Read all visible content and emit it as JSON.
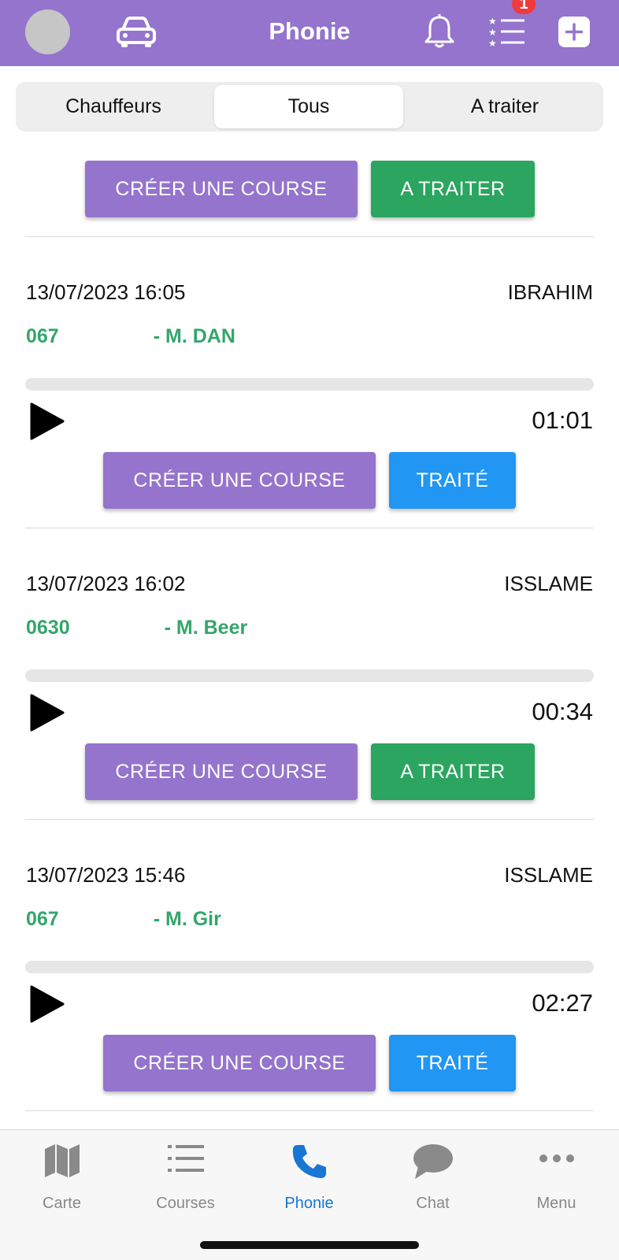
{
  "header": {
    "title": "Phonie",
    "notification_badge": "1",
    "icons": [
      "avatar",
      "car-icon",
      "bell-icon",
      "list-icon",
      "plus-icon"
    ]
  },
  "segment": {
    "items": [
      {
        "label": "Chauffeurs",
        "active": false
      },
      {
        "label": "Tous",
        "active": true
      },
      {
        "label": "A traiter",
        "active": false
      }
    ]
  },
  "top_actions": {
    "create_label": "CRÉER UNE COURSE",
    "status_label": "A TRAITER"
  },
  "calls": [
    {
      "datetime": "13/07/2023 16:05",
      "driver": "IBRAHIM",
      "phone_prefix": "067",
      "client": "- M. DAN",
      "duration": "01:01",
      "create_label": "CRÉER UNE COURSE",
      "status_label": "TRAITÉ",
      "status": "treated"
    },
    {
      "datetime": "13/07/2023 16:02",
      "driver": "ISSLAME",
      "phone_prefix": "0630",
      "client": "- M. Beer",
      "duration": "00:34",
      "create_label": "CRÉER UNE COURSE",
      "status_label": "A TRAITER",
      "status": "to_treat"
    },
    {
      "datetime": "13/07/2023 15:46",
      "driver": "ISSLAME",
      "phone_prefix": "067",
      "client": "- M. Gir",
      "duration": "02:27",
      "create_label": "CRÉER UNE COURSE",
      "status_label": "TRAITÉ",
      "status": "treated"
    }
  ],
  "bottom_nav": {
    "items": [
      {
        "label": "Carte",
        "icon": "map-icon",
        "active": false
      },
      {
        "label": "Courses",
        "icon": "list-icon",
        "active": false
      },
      {
        "label": "Phonie",
        "icon": "phone-icon",
        "active": true
      },
      {
        "label": "Chat",
        "icon": "chat-bubble-icon",
        "active": false
      },
      {
        "label": "Menu",
        "icon": "more-dots-icon",
        "active": false
      }
    ]
  },
  "colors": {
    "primary": "#9474cc",
    "green": "#2ba560",
    "blue": "#2196f3",
    "phone_text": "#34a56b",
    "active_nav": "#1976d2",
    "badge": "#ef3b3b"
  }
}
